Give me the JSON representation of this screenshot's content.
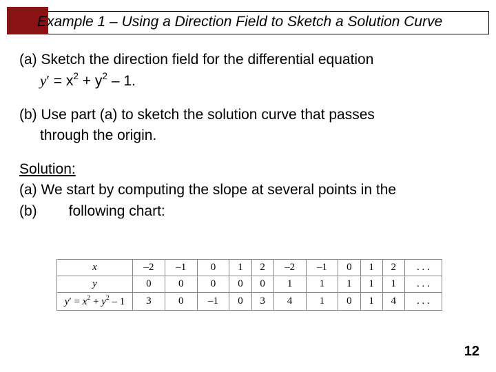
{
  "title": "Example 1 – Using a Direction Field to Sketch a Solution Curve",
  "partA": {
    "lead": "(a) Sketch the direction field for the differential equation",
    "eq_prefix": "y",
    "eq_mid": " = x",
    "eq_mid2": " + y",
    "eq_tail": " – 1."
  },
  "partB": {
    "l1": "(b) Use part (a) to sketch the solution curve that passes",
    "l2": "through the origin."
  },
  "solution": {
    "label": "Solution:",
    "a1_prefix": "(a)",
    "a1_text": " We start by computing the slope at several points in the",
    "a2_prefix": "(b)",
    "a2_text": "following chart:"
  },
  "chart_data": {
    "type": "table",
    "rows": [
      {
        "label_html": "<span class='var'>x</span>",
        "cells": [
          "–2",
          "–1",
          "0",
          "1",
          "2",
          "–2",
          "–1",
          "0",
          "1",
          "2",
          ". . ."
        ]
      },
      {
        "label_html": "<span class='var'>y</span>",
        "cells": [
          "0",
          "0",
          "0",
          "0",
          "0",
          "1",
          "1",
          "1",
          "1",
          "1",
          ". . ."
        ]
      },
      {
        "label_html": "<span class='var'>y</span><span class='prime'>′</span> = <span class='var'>x</span><sup>2</sup> + <span class='var'>y</span><sup>2</sup> – 1",
        "cells": [
          "3",
          "0",
          "–1",
          "0",
          "3",
          "4",
          "1",
          "0",
          "1",
          "4",
          ". . ."
        ]
      }
    ]
  },
  "page": "12"
}
